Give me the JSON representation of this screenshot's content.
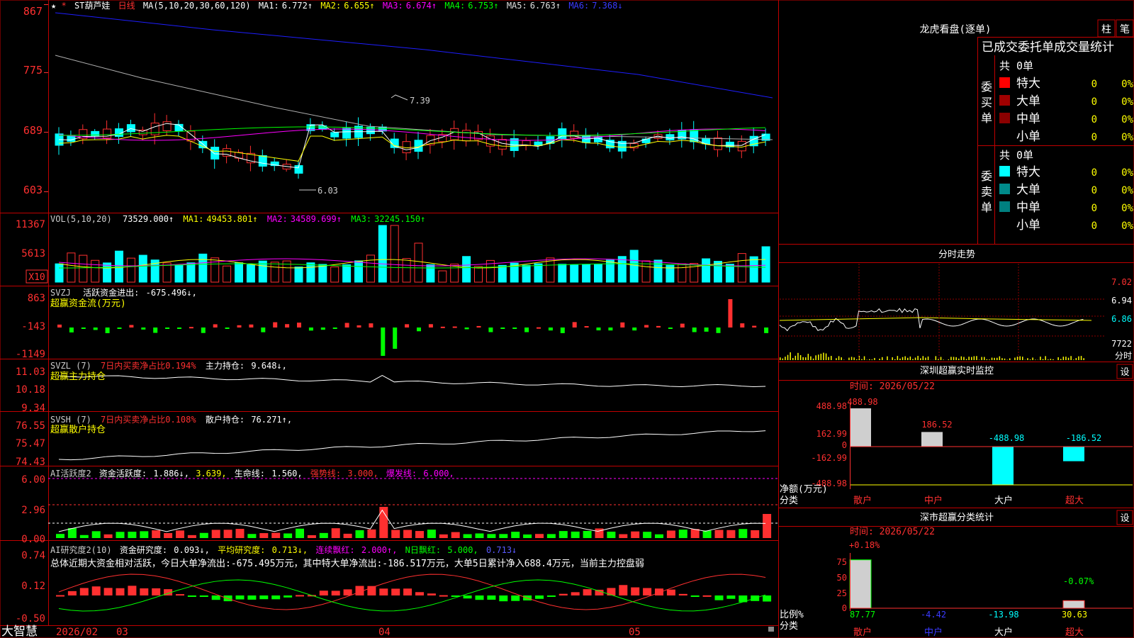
{
  "colors": {
    "up": "#ff3030",
    "down": "#00ffff",
    "grid": "#8b0000",
    "border": "#c00000",
    "ma1": "#ffffff",
    "ma2": "#ffff00",
    "ma3": "#ff00ff",
    "ma4": "#00ff00",
    "ma5": "#b0b0b0",
    "ma6": "#1e1eff"
  },
  "icons": {
    "star": "star-icon",
    "arrow_up": "arrow-up-icon",
    "arrow_down": "arrow-down-icon",
    "lock": "lock-icon"
  },
  "price": {
    "star": "★",
    "name": "ST葫芦娃",
    "period": "日线",
    "ma_label": "MA(5,10,20,30,60,120)",
    "ma": [
      {
        "label": "MA1:",
        "value": "6.772↑"
      },
      {
        "label": "MA2:",
        "value": "6.655↑"
      },
      {
        "label": "MA3:",
        "value": "6.674↑"
      },
      {
        "label": "MA4:",
        "value": "6.753↑"
      },
      {
        "label": "MA5:",
        "value": "6.763↑"
      },
      {
        "label": "MA6:",
        "value": "7.368↓"
      }
    ],
    "axis": [
      "867",
      "775",
      "689",
      "603"
    ],
    "high_label": "7.39",
    "low_label": "6.03"
  },
  "vol": {
    "title": "VOL(5,10,20)",
    "value": "73529.000↑",
    "ma": [
      {
        "label": "MA1:",
        "value": "49453.801↑"
      },
      {
        "label": "MA2:",
        "value": "34589.699↑"
      },
      {
        "label": "MA3:",
        "value": "32245.150↑"
      }
    ],
    "axis": [
      "11367",
      "5613"
    ],
    "unit": "X10"
  },
  "svzj": {
    "code": "SVZJ",
    "name": "活跃资金进出:",
    "value": "-675.496↓,",
    "title": "超赢资金流(万元)",
    "axis": [
      "863",
      "-143",
      "-1149"
    ]
  },
  "svzl": {
    "code": "SVZL (7)",
    "text1": "7日内买卖净占比0.194%",
    "label2": "主力持仓:",
    "value2": "9.648↓,",
    "title": "超赢主力持仓",
    "axis": [
      "11.03",
      "10.18",
      "9.34"
    ]
  },
  "svsh": {
    "code": "SVSH (7)",
    "text1": "7日内买卖净占比0.108%",
    "label2": "散户持仓:",
    "value2": "76.271↑,",
    "title": "超赢散户持仓",
    "axis": [
      "76.55",
      "75.47",
      "74.43"
    ]
  },
  "ai1": {
    "code": "AI活跃度2",
    "label1": "资金活跃度:",
    "v1": "1.886↓,",
    "v2": "3.639,",
    "label3": "生命线:",
    "v3": "1.560,",
    "label4": "强势线:",
    "v4": "3.000,",
    "label5": "爆发线:",
    "v5": "6.000,",
    "axis": [
      "6.00",
      "2.96",
      "0.00"
    ]
  },
  "ai2": {
    "code": "AI研究度2(10)",
    "label1": "资金研究度:",
    "v1": "0.093↓,",
    "label2": "平均研究度:",
    "v2": "0.713↓,",
    "label3": "连续飘红:",
    "v3": "2.000↑,",
    "label4": "N日飘红:",
    "v4": "5.000,",
    "v5": "0.713↓",
    "summary": "总体近期大资金相对活跃，今日大单净流出:-675.495万元，其中特大单净流出:-186.517万元，大单5日累计净入688.4万元，当前主力控盘弱",
    "axis": [
      "0.74",
      "0.12",
      "-0.50"
    ]
  },
  "xaxis": {
    "brand": "大智慧",
    "labels": [
      "2026/02",
      "03",
      "04",
      "05"
    ]
  },
  "right": {
    "dragon_title": "龙虎看盘(逐单)",
    "tab1": "柱",
    "tab2": "笔",
    "stat_title": "已成交委托单成交量统计",
    "buy": {
      "side": "委买单",
      "total": "共 0单",
      "rows": [
        {
          "label": "特大",
          "n": "0",
          "p": "0%"
        },
        {
          "label": "大单",
          "n": "0",
          "p": "0%"
        },
        {
          "label": "中单",
          "n": "0",
          "p": "0%"
        },
        {
          "label": "小单",
          "n": "0",
          "p": "0%"
        }
      ]
    },
    "sell": {
      "side": "委卖单",
      "total": "共 0单",
      "rows": [
        {
          "label": "特大",
          "n": "0",
          "p": "0%"
        },
        {
          "label": "大单",
          "n": "0",
          "p": "0%"
        },
        {
          "label": "中单",
          "n": "0",
          "p": "0%"
        },
        {
          "label": "小单",
          "n": "0",
          "p": "0%"
        }
      ]
    },
    "intraday": {
      "title": "分时走势",
      "axis": [
        "7.02",
        "6.94",
        "6.86",
        "7722",
        "分时"
      ]
    },
    "monitor": {
      "title": "深圳超赢实时监控",
      "set": "设",
      "time": "时间: 2026/05/22",
      "ylabel": "净额(万元)",
      "xlabel": "分类",
      "axis": [
        "488.98",
        "162.99",
        "0",
        "-162.99",
        "-488.98"
      ],
      "cats": [
        "散户",
        "中户",
        "大户",
        "超大"
      ],
      "vals": [
        "488.98",
        "186.52",
        "-488.98",
        "-186.52"
      ]
    },
    "classify": {
      "title": "深市超赢分类统计",
      "set": "设",
      "time": "时间: 2026/05/22",
      "ylabel": "比例%",
      "xlabel": "分类",
      "axis": [
        "75",
        "50",
        "25",
        "0"
      ],
      "cats": [
        "散户",
        "中户",
        "大户",
        "超大"
      ],
      "vals": [
        "87.77",
        "-4.42",
        "-13.98",
        "30.63"
      ],
      "top1": "+0.18%",
      "top2": "-0.07%"
    }
  }
}
